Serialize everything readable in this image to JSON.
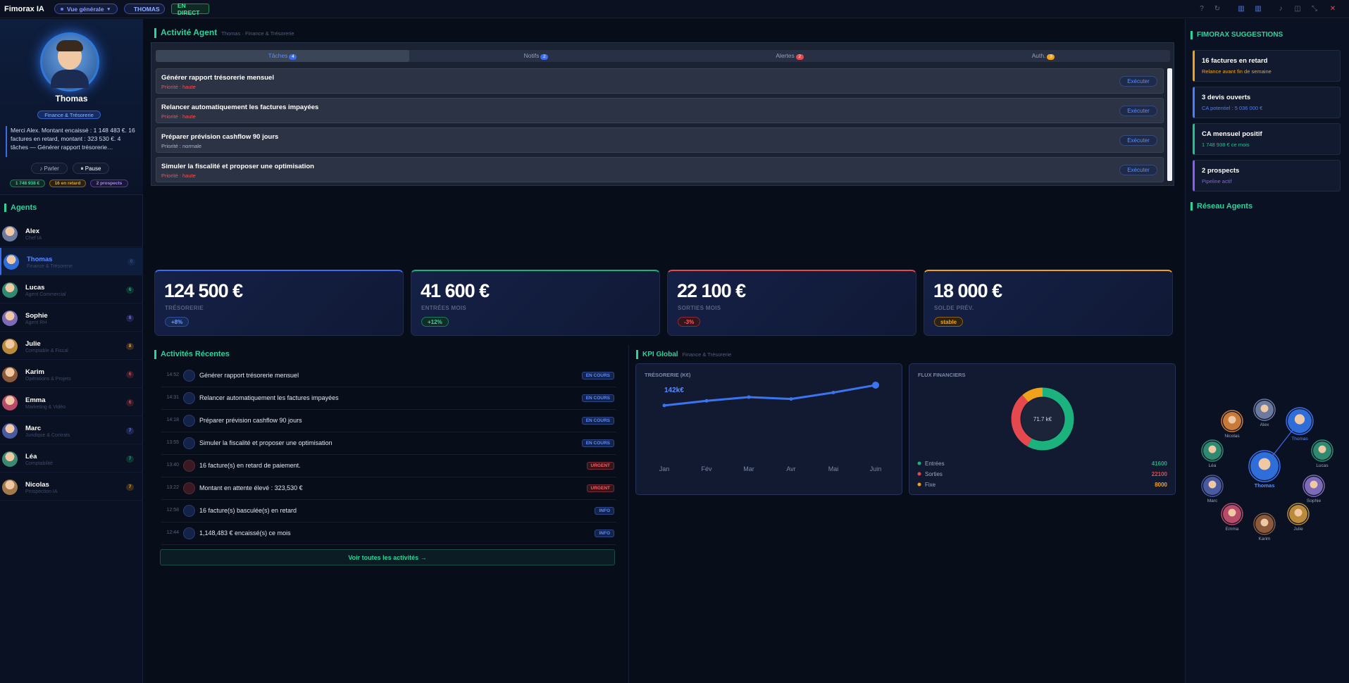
{
  "topbar": {
    "brand": "Fimorax IA",
    "view_label": "Vue générale",
    "user_label": "THOMAS",
    "live_label": "EN DIRECT"
  },
  "profile": {
    "name": "Thomas",
    "role": "Finance & Trésorerie",
    "message": "Merci Alex. Montant encaissé : 1 148 483 €. 16 factures en retard, montant : 323 530 €. 4 tâches — Générer rapport trésorerie…",
    "talk_label": "Parler",
    "pause_label": "Pause",
    "chips": [
      "1 748 938 €",
      "16 en retard",
      "2 prospects"
    ]
  },
  "agents_title": "Agents",
  "agents": [
    {
      "name": "Alex",
      "role": "Chef IA",
      "count": ""
    },
    {
      "name": "Thomas",
      "role": "Finance & Trésorerie",
      "count": "0"
    },
    {
      "name": "Lucas",
      "role": "Agent Commercial",
      "count": "6"
    },
    {
      "name": "Sophie",
      "role": "Agent RH",
      "count": "8"
    },
    {
      "name": "Julie",
      "role": "Comptable & Fiscal",
      "count": "8"
    },
    {
      "name": "Karim",
      "role": "Opérations & Projets",
      "count": "6"
    },
    {
      "name": "Emma",
      "role": "Marketing & Vidéo",
      "count": "6"
    },
    {
      "name": "Marc",
      "role": "Juridique & Contrats",
      "count": "7"
    },
    {
      "name": "Léa",
      "role": "Comptabilité",
      "count": "7"
    },
    {
      "name": "Nicolas",
      "role": "Prospection IA",
      "count": "7"
    }
  ],
  "agent_activity": {
    "title": "Activité Agent",
    "subtitle": "Thomas · Finance & Trésorerie",
    "tabs": [
      {
        "label": "Tâches",
        "count": "4"
      },
      {
        "label": "Notifs",
        "count": "2"
      },
      {
        "label": "Alertes",
        "count": "2"
      },
      {
        "label": "Auth.",
        "count": "3"
      }
    ],
    "tasks": [
      {
        "title": "Générer rapport trésorerie mensuel",
        "priority": "Priorité : haute"
      },
      {
        "title": "Relancer automatiquement les factures impayées",
        "priority": "Priorité : haute"
      },
      {
        "title": "Préparer prévision cashflow 90 jours",
        "priority": "Priorité : normale"
      },
      {
        "title": "Simuler la fiscalité et proposer une optimisation",
        "priority": "Priorité : haute"
      }
    ],
    "execute_label": "Exécuter"
  },
  "kpi_cards": [
    {
      "value": "124 500 €",
      "label": "TRÉSORERIE",
      "change": "+8%"
    },
    {
      "value": "41 600 €",
      "label": "ENTRÉES MOIS",
      "change": "+12%"
    },
    {
      "value": "22 100 €",
      "label": "SORTIES MOIS",
      "change": "-3%"
    },
    {
      "value": "18 000 €",
      "label": "SOLDE PRÉV.",
      "change": "stable"
    }
  ],
  "recent": {
    "title": "Activités Récentes",
    "rows": [
      {
        "time": "14:52",
        "text": "Générer rapport trésorerie mensuel",
        "badge": "EN COURS"
      },
      {
        "time": "14:31",
        "text": "Relancer automatiquement les factures impayées",
        "badge": "EN COURS"
      },
      {
        "time": "14:18",
        "text": "Préparer prévision cashflow 90 jours",
        "badge": "EN COURS"
      },
      {
        "time": "13:55",
        "text": "Simuler la fiscalité et proposer une optimisation",
        "badge": "EN COURS"
      },
      {
        "time": "13:40",
        "text": "16 facture(s) en retard de paiement.",
        "badge": "URGENT"
      },
      {
        "time": "13:22",
        "text": "Montant en attente élevé : 323,530 €",
        "badge": "URGENT"
      },
      {
        "time": "12:58",
        "text": "16 facture(s) basculée(s) en retard",
        "badge": "INFO"
      },
      {
        "time": "12:44",
        "text": "1,148,483 € encaissé(s) ce mois",
        "badge": "INFO"
      }
    ],
    "see_all": "Voir toutes les activités →"
  },
  "kpi_global": {
    "title": "KPI Global",
    "subtitle": "Finance & Trésorerie",
    "line_title": "TRÉSORERIE (K€)",
    "line_value_label": "142k€",
    "donut_title": "FLUX FINANCIERS",
    "donut_center": "71.7 k€"
  },
  "chart_data": [
    {
      "type": "line",
      "title": "TRÉSORERIE (K€)",
      "categories": [
        "Jan",
        "Fév",
        "Mar",
        "Avr",
        "Mai",
        "Juin"
      ],
      "values": [
        120,
        125,
        129,
        127,
        134,
        142
      ],
      "color": "#3b74f0"
    },
    {
      "type": "pie",
      "title": "FLUX FINANCIERS",
      "labels": [
        "Entrées",
        "Sorties",
        "Fixe"
      ],
      "values": [
        41600,
        22100,
        8000
      ],
      "colors": [
        "#1bb27e",
        "#e5484d",
        "#f0a21a"
      ]
    }
  ],
  "suggestions": {
    "title": "FIMORAX SUGGESTIONS",
    "items": [
      {
        "title": "16 factures en retard",
        "detail": "Relance avant fin de semaine",
        "color": "#f0a21a"
      },
      {
        "title": "3 devis ouverts",
        "detail": "CA potentiel : 5 036 000 €",
        "color": "#4a7dff"
      },
      {
        "title": "CA mensuel positif",
        "detail": "1 748 938 € ce mois",
        "color": "#22c48a"
      },
      {
        "title": "2 prospects",
        "detail": "Pipeline actif",
        "color": "#8a5cf6"
      }
    ]
  },
  "network": {
    "title": "Réseau Agents",
    "nodes": [
      "Nicolas",
      "Alex",
      "Thomas",
      "Léa",
      "Lucas",
      "Thomas",
      "Marc",
      "Sophie",
      "Emma",
      "Julie",
      "Karim"
    ]
  }
}
